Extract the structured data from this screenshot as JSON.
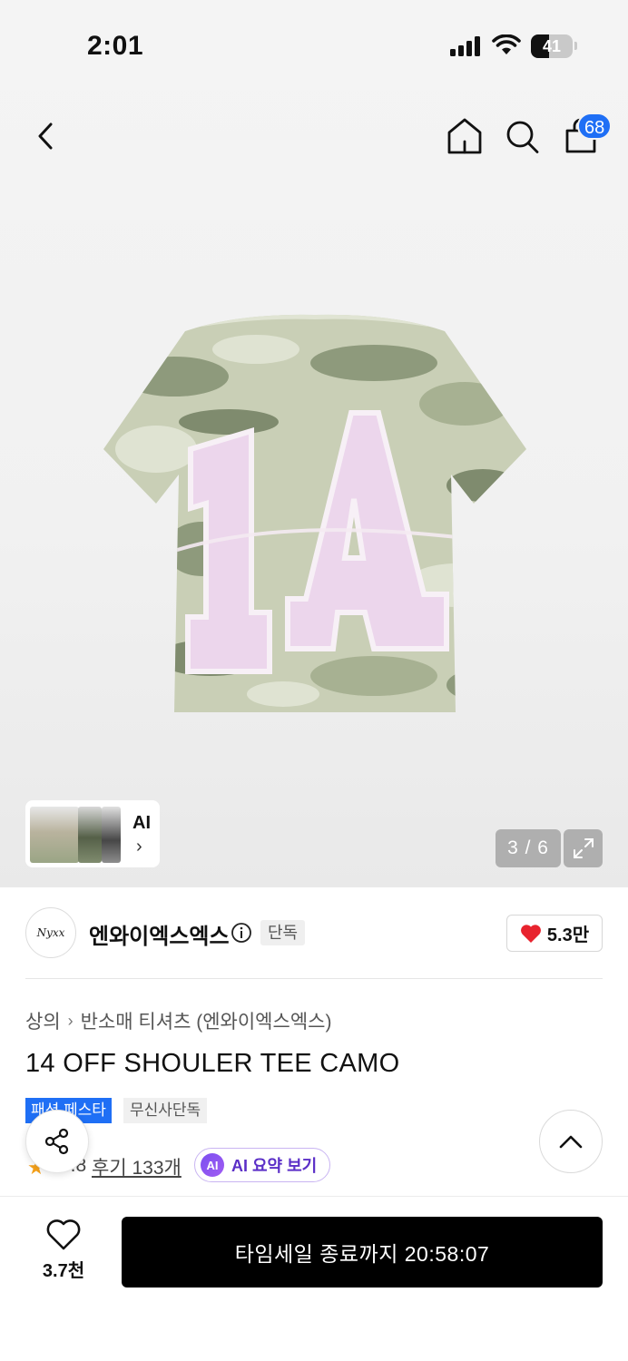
{
  "status_bar": {
    "time": "2:01",
    "battery": "41"
  },
  "nav": {
    "cart_count": "68"
  },
  "gallery": {
    "counter": "3 / 6",
    "ai_label": "AI"
  },
  "brand": {
    "logo_text": "Nyxx",
    "name": "엔와이엑스엑스",
    "exclusive_tag": "단독",
    "like_count": "5.3만"
  },
  "breadcrumb": {
    "category": "상의",
    "subcategory": "반소매 티셔츠 (엔와이엑스엑스)"
  },
  "product": {
    "title": "14 OFF SHOULER TEE CAMO",
    "tag_event": "패션 페스타",
    "tag_exclusive": "무신사단독"
  },
  "rating": {
    "value": "4.8",
    "review_link": "후기 133개",
    "ai_summary_label": "AI 요약 보기",
    "ai_badge": "AI"
  },
  "bottom_bar": {
    "wish_count": "3.7천",
    "cta_label": "타임세일 종료까지 20:58:07"
  },
  "colors": {
    "accent_blue": "#1f6ff5",
    "cta_black": "#000000",
    "heart_red": "#e8232e",
    "ai_purple": "#5b2fc7"
  },
  "icons": [
    "back-icon",
    "home-icon",
    "search-icon",
    "cart-icon",
    "expand-icon",
    "info-icon",
    "heart-icon",
    "share-icon",
    "chevron-up-icon",
    "star-icon"
  ]
}
